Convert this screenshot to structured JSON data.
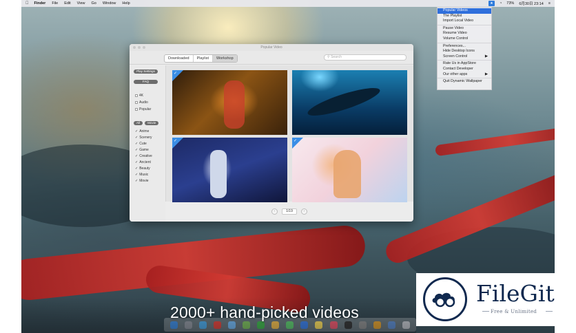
{
  "menubar": {
    "apple_icon": "apple-icon",
    "items": [
      "Finder",
      "File",
      "Edit",
      "View",
      "Go",
      "Window",
      "Help"
    ],
    "status_app_glyph": "★",
    "wifi": "◔",
    "battery": "73%",
    "datetime": "6月30日 23:14",
    "list_icon": "≡"
  },
  "status_menu": {
    "items": [
      {
        "label": "Popular Videos",
        "active": true
      },
      {
        "label": "The Playlist"
      },
      {
        "label": "Import Local Video"
      },
      {
        "sep": true
      },
      {
        "label": "Pause Video"
      },
      {
        "label": "Resume Video"
      },
      {
        "label": "Volume Control"
      },
      {
        "sep": true
      },
      {
        "label": "Preferences..."
      },
      {
        "label": "Hide Desktop Icons"
      },
      {
        "label": "Screen Control",
        "arrow": "▶"
      },
      {
        "sep": true
      },
      {
        "label": "Rate Us in AppStore"
      },
      {
        "label": "Contact Developer"
      },
      {
        "label": "Our other apps",
        "arrow": "▶"
      },
      {
        "sep": true
      },
      {
        "label": "Quit Dynamic Wallpaper"
      }
    ]
  },
  "window": {
    "title": "Popular Video",
    "tabs": [
      "Downloaded",
      "Playlist",
      "Workshop"
    ],
    "active_tab": 2,
    "search_placeholder": "Search",
    "sidebar": {
      "play_settings": "Play Settings",
      "faq": "FAQ",
      "options": [
        "4K",
        "Audio",
        "Popular"
      ],
      "tags": [
        "All",
        "Movie"
      ],
      "categories": [
        "Anime",
        "Scenery",
        "Cute",
        "Game",
        "Creative",
        "Ancient",
        "Beauty",
        "Music",
        "Movie"
      ]
    },
    "pager": {
      "prev": "‹",
      "page": "1/19",
      "next": "›"
    },
    "check_glyph": "✓"
  },
  "caption": "2000+ hand-picked videos",
  "watermark": {
    "name": "FileGit",
    "tagline": "Free & Unlimited"
  }
}
